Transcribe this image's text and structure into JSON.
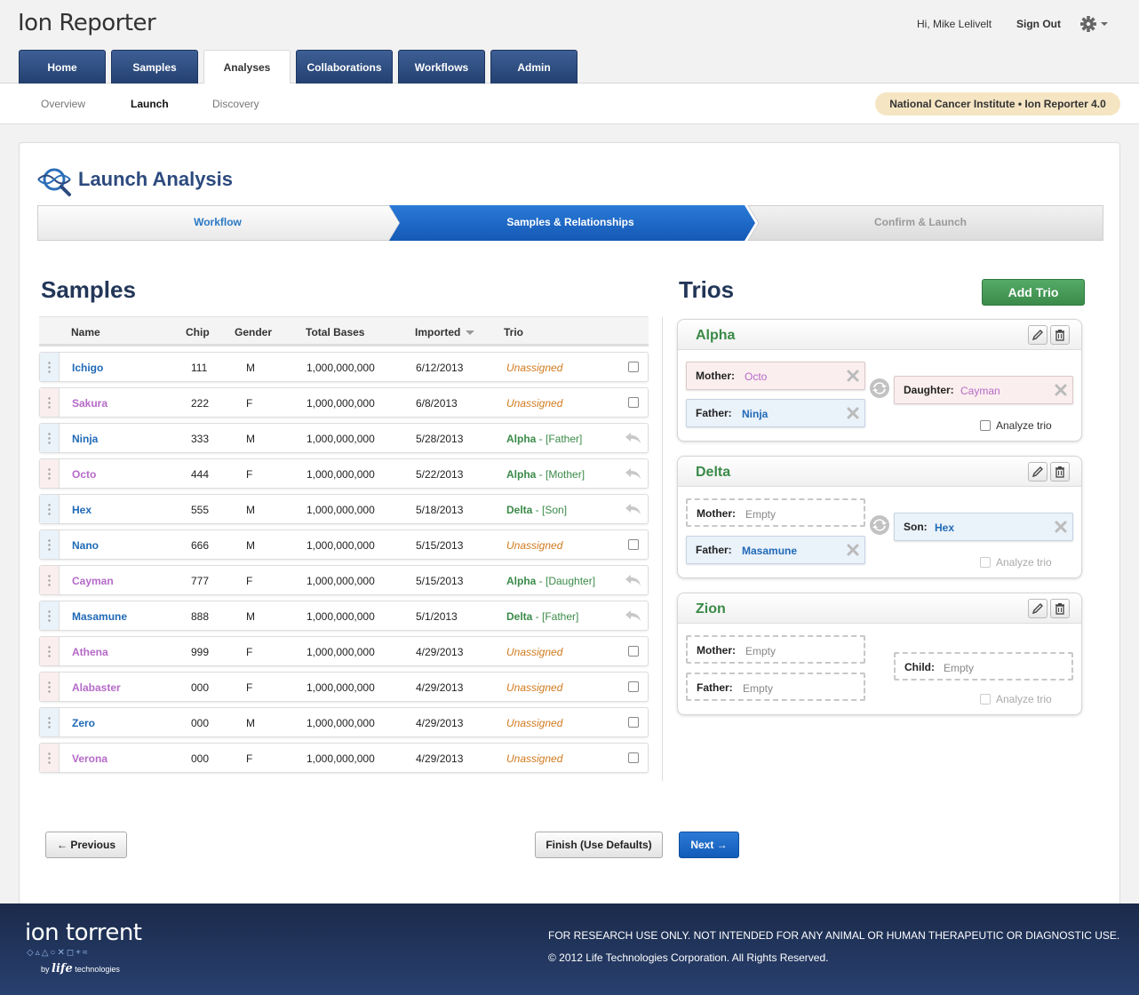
{
  "header": {
    "app_title": "Ion Reporter",
    "greeting": "Hi, Mike Lelivelt",
    "signout": "Sign Out",
    "settings_icon": "gear-icon"
  },
  "main_tabs": [
    {
      "label": "Home",
      "active": false
    },
    {
      "label": "Samples",
      "active": false
    },
    {
      "label": "Analyses",
      "active": true
    },
    {
      "label": "Collaborations",
      "active": false
    },
    {
      "label": "Workflows",
      "active": false
    },
    {
      "label": "Admin",
      "active": false
    }
  ],
  "sub_nav": [
    {
      "label": "Overview",
      "active": false
    },
    {
      "label": "Launch",
      "active": true
    },
    {
      "label": "Discovery",
      "active": false
    }
  ],
  "org_badge": "National Cancer Institute  •  Ion Reporter 4.0",
  "page": {
    "title": "Launch Analysis"
  },
  "wizard": {
    "steps": [
      {
        "label": "Workflow",
        "state": "done"
      },
      {
        "label": "Samples & Relationships",
        "state": "active"
      },
      {
        "label": "Confirm & Launch",
        "state": "pending"
      }
    ]
  },
  "samples": {
    "title": "Samples",
    "columns": [
      "Name",
      "Chip",
      "Gender",
      "Total Bases",
      "Imported",
      "Trio"
    ],
    "rows": [
      {
        "name": "Ichigo",
        "chip": "111",
        "gender": "M",
        "bases": "1,000,000,000",
        "imported": "6/12/2013",
        "trio": "Unassigned",
        "trio_role": ""
      },
      {
        "name": "Sakura",
        "chip": "222",
        "gender": "F",
        "bases": "1,000,000,000",
        "imported": "6/8/2013",
        "trio": "Unassigned",
        "trio_role": ""
      },
      {
        "name": "Ninja",
        "chip": "333",
        "gender": "M",
        "bases": "1,000,000,000",
        "imported": "5/28/2013",
        "trio": "Alpha",
        "trio_role": " - [Father]"
      },
      {
        "name": "Octo",
        "chip": "444",
        "gender": "F",
        "bases": "1,000,000,000",
        "imported": "5/22/2013",
        "trio": "Alpha",
        "trio_role": " - [Mother]"
      },
      {
        "name": "Hex",
        "chip": "555",
        "gender": "M",
        "bases": "1,000,000,000",
        "imported": "5/18/2013",
        "trio": "Delta",
        "trio_role": " - [Son]"
      },
      {
        "name": "Nano",
        "chip": "666",
        "gender": "M",
        "bases": "1,000,000,000",
        "imported": "5/15/2013",
        "trio": "Unassigned",
        "trio_role": ""
      },
      {
        "name": "Cayman",
        "chip": "777",
        "gender": "F",
        "bases": "1,000,000,000",
        "imported": "5/15/2013",
        "trio": "Alpha",
        "trio_role": " - [Daughter]"
      },
      {
        "name": "Masamune",
        "chip": "888",
        "gender": "M",
        "bases": "1,000,000,000",
        "imported": "5/1/2013",
        "trio": "Delta",
        "trio_role": " - [Father]"
      },
      {
        "name": "Athena",
        "chip": "999",
        "gender": "F",
        "bases": "1,000,000,000",
        "imported": "4/29/2013",
        "trio": "Unassigned",
        "trio_role": ""
      },
      {
        "name": "Alabaster",
        "chip": "000",
        "gender": "F",
        "bases": "1,000,000,000",
        "imported": "4/29/2013",
        "trio": "Unassigned",
        "trio_role": ""
      },
      {
        "name": "Zero",
        "chip": "000",
        "gender": "M",
        "bases": "1,000,000,000",
        "imported": "4/29/2013",
        "trio": "Unassigned",
        "trio_role": ""
      },
      {
        "name": "Verona",
        "chip": "000",
        "gender": "F",
        "bases": "1,000,000,000",
        "imported": "4/29/2013",
        "trio": "Unassigned",
        "trio_role": ""
      }
    ]
  },
  "trios": {
    "title": "Trios",
    "add_label": "Add Trio",
    "cards": [
      {
        "name": "Alpha",
        "mother": {
          "label": "Mother:",
          "value": "Octo",
          "filled": true
        },
        "father": {
          "label": "Father:",
          "value": "Ninja",
          "filled": true
        },
        "child": {
          "label": "Daughter:",
          "value": "Cayman",
          "filled": true,
          "gender": "F"
        },
        "analyze_label": "Analyze trio",
        "analyze_enabled": true
      },
      {
        "name": "Delta",
        "mother": {
          "label": "Mother:",
          "value": "Empty",
          "filled": false
        },
        "father": {
          "label": "Father:",
          "value": "Masamune",
          "filled": true
        },
        "child": {
          "label": "Son:",
          "value": "Hex",
          "filled": true,
          "gender": "M"
        },
        "analyze_label": "Analyze trio",
        "analyze_enabled": false
      },
      {
        "name": "Zion",
        "mother": {
          "label": "Mother:",
          "value": "Empty",
          "filled": false
        },
        "father": {
          "label": "Father:",
          "value": "Empty",
          "filled": false
        },
        "child": {
          "label": "Child:",
          "value": "Empty",
          "filled": false,
          "gender": ""
        },
        "analyze_label": "Analyze trio",
        "analyze_enabled": false
      }
    ]
  },
  "buttons": {
    "previous": "← Previous",
    "finish": "Finish (Use Defaults)",
    "next": "Next →"
  },
  "footer": {
    "brand": "ion torrent",
    "brand_shapes": "◇▵△○✕◻+≈",
    "brand_by": "by",
    "brand_life": "life",
    "brand_tech": "technologies",
    "legal_1": "FOR RESEARCH USE ONLY. NOT INTENDED FOR ANY ANIMAL OR HUMAN THERAPEUTIC OR DIAGNOSTIC USE.",
    "legal_2": "© 2012 Life Technologies Corporation. All Rights Reserved."
  }
}
